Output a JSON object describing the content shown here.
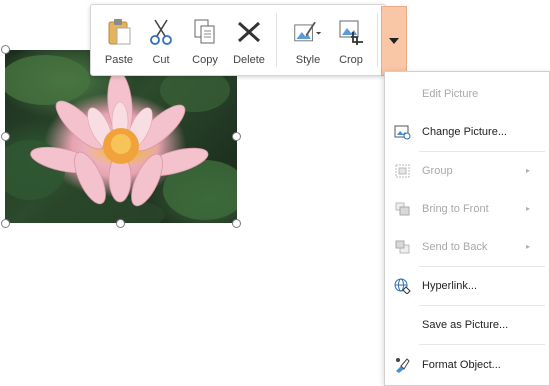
{
  "toolbar": {
    "paste": {
      "label": "Paste",
      "icon": "clipboard-paste-icon"
    },
    "cut": {
      "label": "Cut",
      "icon": "scissors-icon"
    },
    "copy": {
      "label": "Copy",
      "icon": "copy-icon"
    },
    "delete": {
      "label": "Delete",
      "icon": "delete-x-icon"
    },
    "style": {
      "label": "Style",
      "icon": "picture-style-icon"
    },
    "crop": {
      "label": "Crop",
      "icon": "crop-icon"
    },
    "more": {
      "icon": "caret-down-icon"
    },
    "accent_color": "#f9c6a6"
  },
  "menu": {
    "items": [
      {
        "label": "Edit Picture",
        "enabled": false
      },
      {
        "label": "Change Picture...",
        "enabled": true,
        "icon": "change-picture-icon"
      },
      {
        "label": "Group",
        "enabled": false,
        "icon": "group-icon",
        "submenu": true
      },
      {
        "label": "Bring to Front",
        "enabled": false,
        "icon": "bring-to-front-icon",
        "submenu": true
      },
      {
        "label": "Send to Back",
        "enabled": false,
        "icon": "send-to-back-icon",
        "submenu": true
      },
      {
        "label": "Hyperlink...",
        "enabled": true,
        "icon": "hyperlink-globe-icon"
      },
      {
        "label": "Save as Picture...",
        "enabled": true
      },
      {
        "label": "Format Object...",
        "enabled": true,
        "icon": "format-object-icon"
      }
    ]
  }
}
